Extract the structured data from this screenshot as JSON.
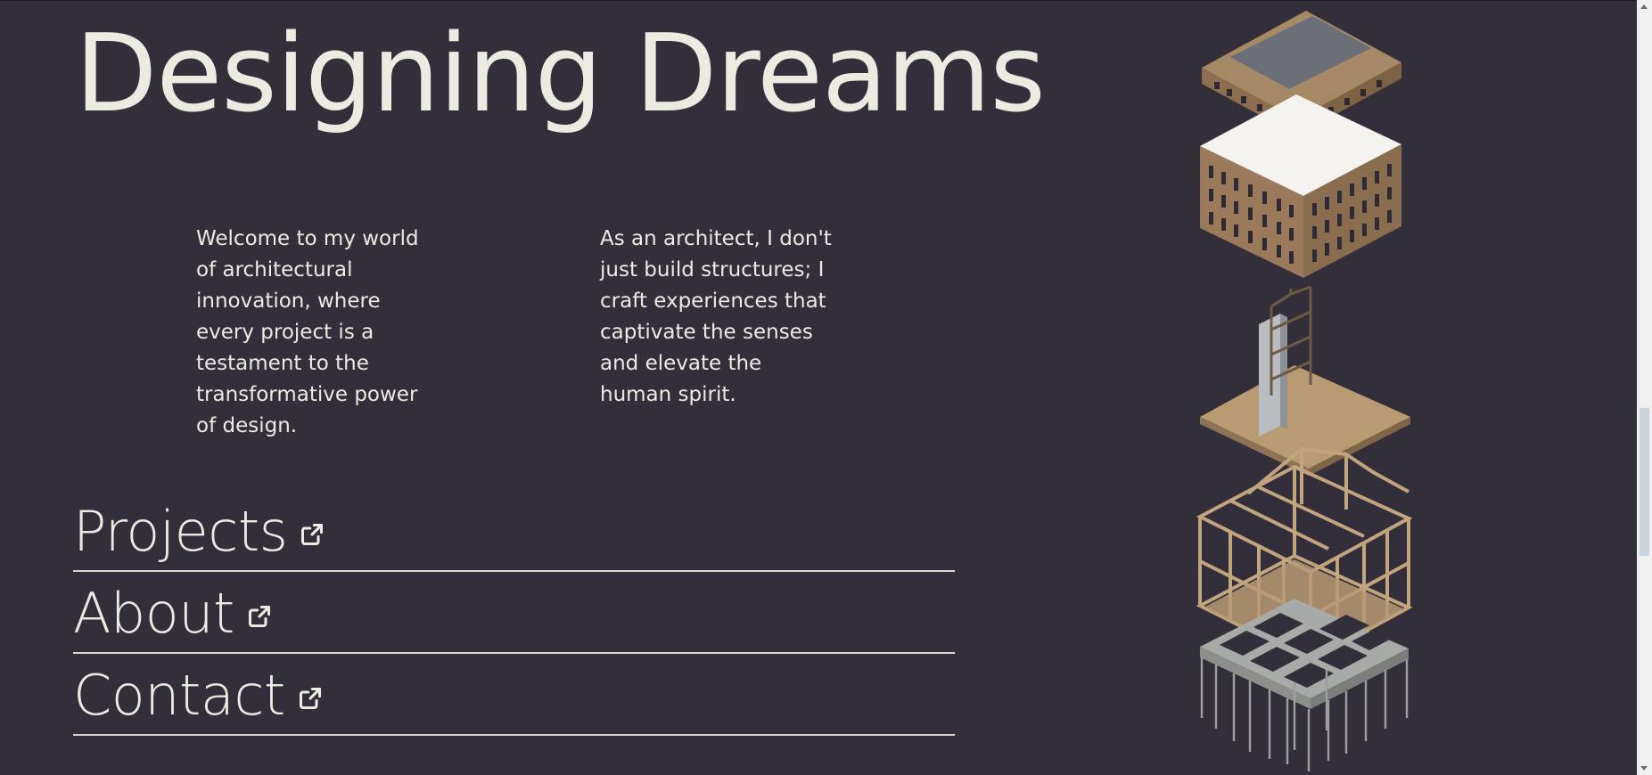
{
  "hero": {
    "title": "Designing Dreams"
  },
  "intro": {
    "left_paragraph": "Welcome to my world of architectural innovation, where every project is a testament to the transformative power of design.",
    "right_paragraph": "As an architect, I don't just build structures; I craft experiences that captivate the senses and elevate the human spirit."
  },
  "nav": {
    "items": [
      {
        "label": "Projects",
        "icon": "external-link-icon"
      },
      {
        "label": "About",
        "icon": "external-link-icon"
      },
      {
        "label": "Contact",
        "icon": "external-link-icon"
      }
    ]
  },
  "illustration": {
    "subject": "exploded axonometric building model"
  },
  "colors": {
    "background": "#322f3b",
    "text": "#ecebe2",
    "divider": "#d8d6cc",
    "timber": "#b89a73",
    "brick": "#9a7a5a",
    "concrete": "#a7aaa6"
  }
}
